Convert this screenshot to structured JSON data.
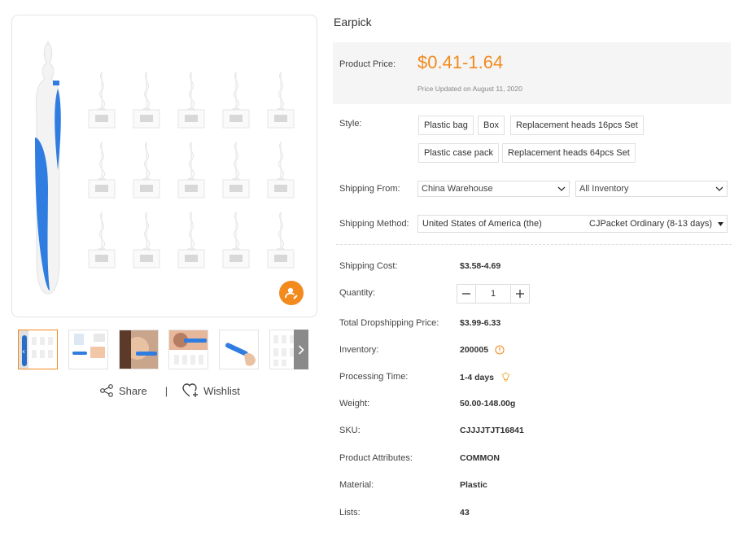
{
  "product": {
    "title": "Earpick",
    "price_label": "Product Price:",
    "price_value": "$0.41-1.64",
    "price_updated": "Price Updated on August 11, 2020"
  },
  "style": {
    "label": "Style:",
    "options": [
      "Plastic bag",
      "Box",
      "Replacement heads 16pcs Set",
      "Plastic case pack",
      "Replacement heads 64pcs Set"
    ]
  },
  "shipping_from": {
    "label": "Shipping From:",
    "warehouse": "China Warehouse",
    "inventory": "All Inventory"
  },
  "shipping_method": {
    "label": "Shipping Method:",
    "country": "United States of America (the)",
    "carrier": "CJPacket Ordinary (8-13 days)"
  },
  "details": {
    "shipping_cost_label": "Shipping Cost:",
    "shipping_cost": "$3.58-4.69",
    "quantity_label": "Quantity:",
    "quantity": "1",
    "total_label": "Total Dropshipping Price:",
    "total": "$3.99-6.33",
    "inventory_label": "Inventory:",
    "inventory": "200005",
    "processing_label": "Processing Time:",
    "processing": "1-4 days",
    "weight_label": "Weight:",
    "weight": "50.00-148.00g",
    "sku_label": "SKU:",
    "sku": "CJJJJTJT16841",
    "attributes_label": "Product Attributes:",
    "attributes": "COMMON",
    "material_label": "Material:",
    "material": "Plastic",
    "lists_label": "Lists:",
    "lists": "43"
  },
  "actions": {
    "share": "Share",
    "separator": "|",
    "wishlist": "Wishlist"
  },
  "colors": {
    "accent": "#f28a1e",
    "product_blue": "#2f7de1"
  }
}
